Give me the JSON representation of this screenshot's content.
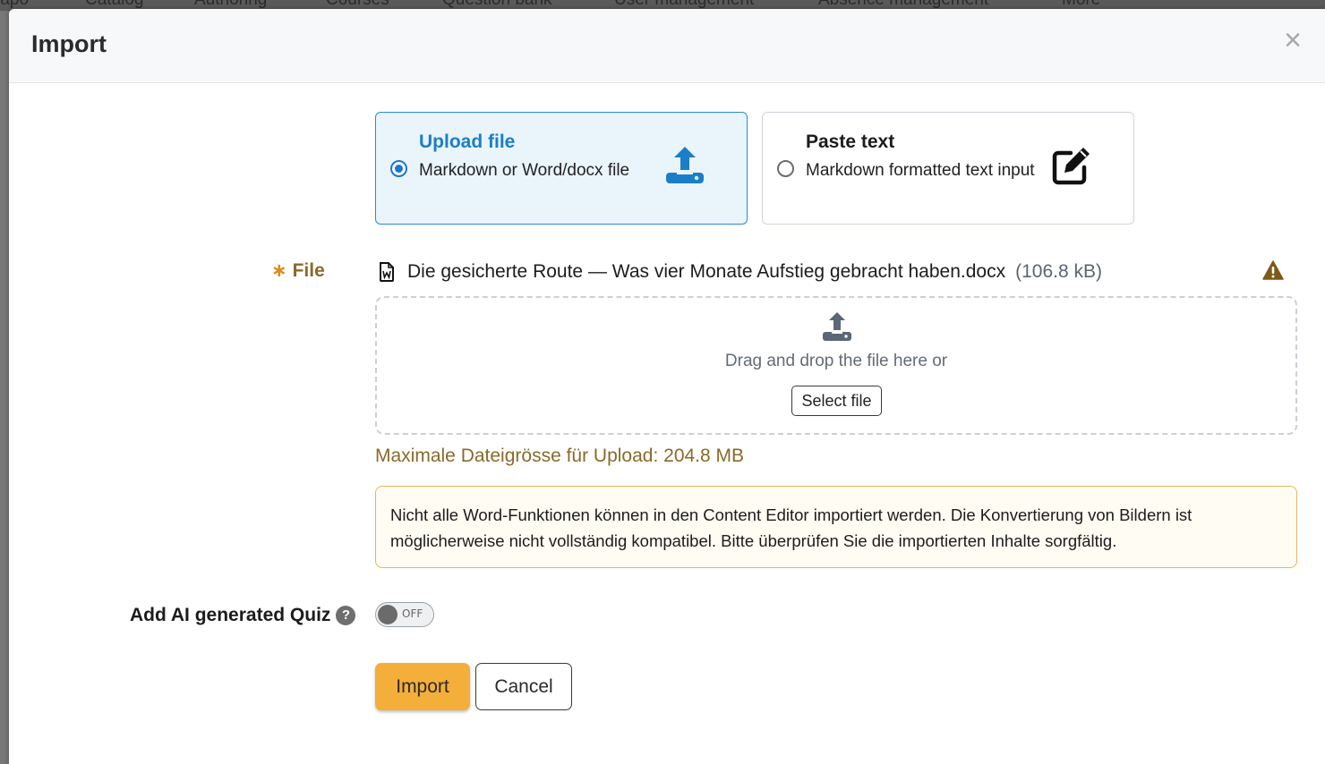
{
  "background_nav": {
    "items": [
      "rapo",
      "Catalog",
      "Authoring",
      "Courses",
      "Question bank",
      "User management",
      "Absence management",
      "More"
    ]
  },
  "modal": {
    "title": "Import",
    "close_label": "×"
  },
  "source_options": [
    {
      "title": "Upload file",
      "description": "Markdown or Word/docx file",
      "selected": true,
      "icon": "upload-icon"
    },
    {
      "title": "Paste text",
      "description": "Markdown formatted text input",
      "selected": false,
      "icon": "edit-icon"
    }
  ],
  "file_field": {
    "required_marker": "∗",
    "label": "File",
    "file_name": "Die gesicherte Route — Was vier Monate Aufstieg gebracht haben.docx",
    "file_size": "(106.8 kB)",
    "file_icon": "word-document-icon",
    "status_icon": "warning-icon"
  },
  "dropzone": {
    "text": "Drag and drop the file here or",
    "select_button": "Select file"
  },
  "max_size_text": "Maximale Dateigrösse für Upload: 204.8 MB",
  "notice_text": "Nicht alle Word-Funktionen können in den Content Editor importiert werden. Die Konvertierung von Bildern ist möglicherweise nicht vollständig kompatibel. Bitte überprüfen Sie die importierten Inhalte sorgfältig.",
  "ai_quiz": {
    "label": "Add AI generated Quiz",
    "help_glyph": "?",
    "toggle_state": "OFF"
  },
  "buttons": {
    "import": "Import",
    "cancel": "Cancel"
  },
  "colors": {
    "accent_blue": "#1a7fc8",
    "primary_button": "#f4ae3a",
    "label_brown": "#8a6a2a",
    "notice_border": "#e2b85a"
  }
}
